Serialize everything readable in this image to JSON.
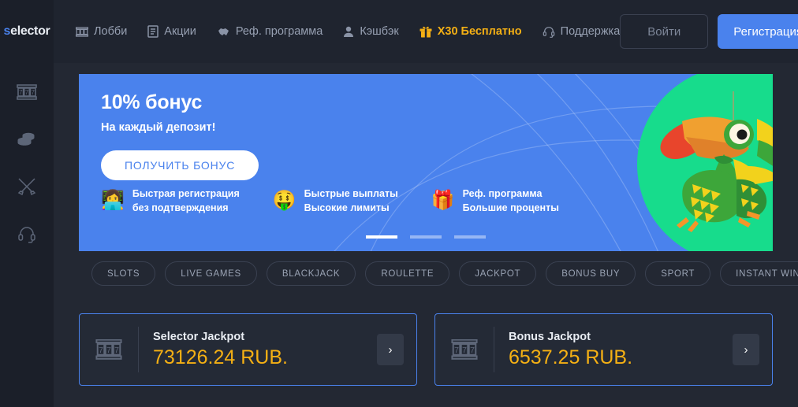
{
  "brand": {
    "logo_prefix": "s",
    "logo_rest": "elector",
    "accent_color": "#4a82ed"
  },
  "sidebar": {
    "items": [
      {
        "name": "slots",
        "icon": "slot-machine-icon"
      },
      {
        "name": "coins",
        "icon": "coins-icon"
      },
      {
        "name": "battles",
        "icon": "crossed-swords-icon"
      },
      {
        "name": "support",
        "icon": "headset-icon"
      }
    ]
  },
  "header": {
    "nav": [
      {
        "label": "Лобби",
        "icon": "slot-machine-icon",
        "highlight": false
      },
      {
        "label": "Акции",
        "icon": "list-document-icon",
        "highlight": false
      },
      {
        "label": "Реф. программа",
        "icon": "handshake-icon",
        "highlight": false
      },
      {
        "label": "Кэшбэк",
        "icon": "person-icon",
        "highlight": false
      },
      {
        "label": "X30 Бесплатно",
        "icon": "gift-icon",
        "highlight": true
      },
      {
        "label": "Поддержка",
        "icon": "headset-icon",
        "highlight": false
      }
    ],
    "login_label": "Войти",
    "register_label": "Регистрация",
    "highlight_color": "#f5b014"
  },
  "banner": {
    "title": "10% бонус",
    "subtitle": "На каждый депозит!",
    "cta_label": "ПОЛУЧИТЬ БОНУС",
    "background_color": "#4a82ed",
    "mascot_circle_color": "#17dc8c",
    "mascot_icon": "parrot-mascot",
    "features": [
      {
        "emoji": "👩‍💻",
        "icon": "person-laptop-emoji",
        "line1": "Быстрая регистрация",
        "line2": "без подтверждения"
      },
      {
        "emoji": "🤑",
        "icon": "money-mouth-emoji",
        "line1": "Быстрые выплаты",
        "line2": "Высокие лимиты"
      },
      {
        "emoji": "🎁",
        "icon": "gift-emoji",
        "line1": "Реф. программа",
        "line2": "Большие проценты"
      }
    ],
    "slides": [
      {
        "active": true
      },
      {
        "active": false
      },
      {
        "active": false
      }
    ]
  },
  "categories": [
    {
      "label": "SLOTS"
    },
    {
      "label": "LIVE GAMES"
    },
    {
      "label": "BLACKJACK"
    },
    {
      "label": "ROULETTE"
    },
    {
      "label": "JACKPOT"
    },
    {
      "label": "BONUS BUY"
    },
    {
      "label": "SPORT"
    },
    {
      "label": "INSTANT WIN"
    }
  ],
  "jackpots": [
    {
      "name": "Selector Jackpot",
      "amount": "73126.24 RUB.",
      "icon": "slot-machine-icon",
      "arrow": "›"
    },
    {
      "name": "Bonus Jackpot",
      "amount": "6537.25 RUB.",
      "icon": "slot-machine-icon",
      "arrow": "›"
    }
  ],
  "colors": {
    "amount": "#f5b014",
    "card_border": "#4a82ed",
    "background": "#232833",
    "sidebar": "#1b1f29"
  }
}
